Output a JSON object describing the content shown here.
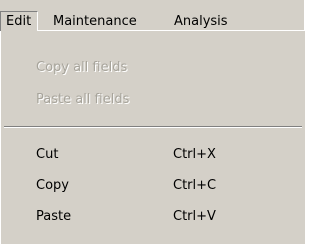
{
  "menubar": {
    "items": [
      {
        "label": "Edit"
      },
      {
        "label": "Maintenance"
      },
      {
        "label": "Analysis"
      }
    ]
  },
  "edit_menu": {
    "items": [
      {
        "label": "Copy all fields",
        "shortcut": "",
        "enabled": false
      },
      {
        "label": "Paste all fields",
        "shortcut": "",
        "enabled": false
      },
      {
        "label": "Cut",
        "shortcut": "Ctrl+X",
        "enabled": true
      },
      {
        "label": "Copy",
        "shortcut": "Ctrl+C",
        "enabled": true
      },
      {
        "label": "Paste",
        "shortcut": "Ctrl+V",
        "enabled": true
      }
    ]
  },
  "colors": {
    "face": "#d4d0c8",
    "disabled_text": "#a7a49b",
    "shadow": "#808080",
    "highlight": "#ffffff"
  }
}
